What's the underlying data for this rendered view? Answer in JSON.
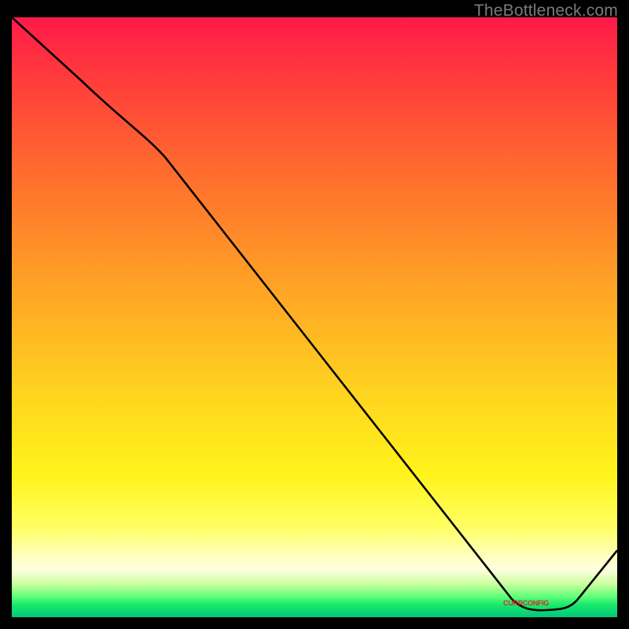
{
  "watermark": "TheBottleneck.com",
  "marker": {
    "label": "CURRCONFIG"
  },
  "chart_data": {
    "type": "line",
    "title": "",
    "xlabel": "",
    "ylabel": "",
    "x": [
      0.0,
      0.24,
      0.83,
      0.92,
      1.0
    ],
    "values": [
      1.0,
      0.8,
      0.03,
      0.01,
      0.11
    ],
    "xlim": [
      0,
      1
    ],
    "ylim": [
      0,
      1
    ],
    "background": "red-green-vertical-gradient",
    "annotations": [
      {
        "text": "CURRCONFIG",
        "x": 0.86,
        "y": 0.015
      }
    ]
  }
}
